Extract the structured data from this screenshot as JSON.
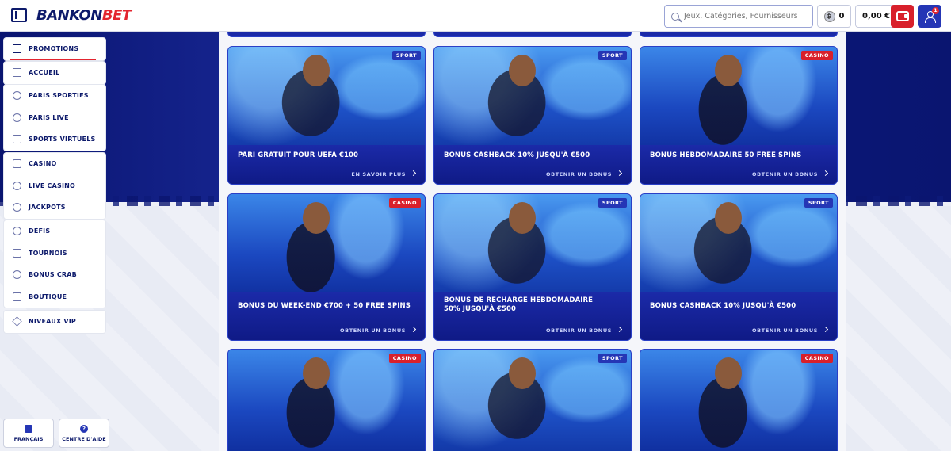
{
  "header": {
    "logo_main": "BANKON",
    "logo_accent": "BET",
    "search_placeholder": "Jeux, Catégories, Fournisseurs",
    "coins": "0",
    "balance": "0,00 €",
    "notification_count": "1"
  },
  "sidebar": {
    "groups": [
      [
        {
          "label": "PROMOTIONS",
          "icon": "gift-icon",
          "active": true
        }
      ],
      [
        {
          "label": "ACCUEIL",
          "icon": "home-icon"
        }
      ],
      [
        {
          "label": "PARIS SPORTIFS",
          "icon": "soccer-ball-icon"
        },
        {
          "label": "PARIS LIVE",
          "icon": "live-signal-icon"
        },
        {
          "label": "SPORTS VIRTUELS",
          "icon": "virtual-sports-icon"
        }
      ],
      [
        {
          "label": "CASINO",
          "icon": "casino-chip-icon"
        },
        {
          "label": "LIVE CASINO",
          "icon": "live-casino-icon"
        },
        {
          "label": "JACKPOTS",
          "icon": "jackpot-icon"
        }
      ],
      [
        {
          "label": "DÉFIS",
          "icon": "medal-icon"
        },
        {
          "label": "TOURNOIS",
          "icon": "trophy-icon"
        },
        {
          "label": "BONUS CRAB",
          "icon": "crab-icon"
        },
        {
          "label": "BOUTIQUE",
          "icon": "shop-bag-icon"
        }
      ],
      [
        {
          "label": "NIVEAUX VIP",
          "icon": "diamond-icon"
        }
      ]
    ],
    "footer": {
      "language": "FRANÇAIS",
      "help": "CENTRE D'AIDE",
      "help_glyph": "?"
    }
  },
  "cards": [
    {
      "title": "PARI GRATUIT POUR UEFA €100",
      "cta": "EN SAVOIR PLUS",
      "badge": "SPORT",
      "type": "sport"
    },
    {
      "title": "BONUS CASHBACK 10% JUSQU'À €500",
      "cta": "OBTENIR UN BONUS",
      "badge": "SPORT",
      "type": "sport"
    },
    {
      "title": "BONUS HEBDOMADAIRE 50 FREE SPINS",
      "cta": "OBTENIR UN BONUS",
      "badge": "CASINO",
      "type": "casino"
    },
    {
      "title": "BONUS DU WEEK-END €700 + 50 FREE SPINS",
      "cta": "OBTENIR UN BONUS",
      "badge": "CASINO",
      "type": "casino"
    },
    {
      "title": "BONUS DE RECHARGE HEBDOMADAIRE 50% JUSQU'À €500",
      "cta": "OBTENIR UN BONUS",
      "badge": "SPORT",
      "type": "sport"
    },
    {
      "title": "BONUS CASHBACK 10% JUSQU'À €500",
      "cta": "OBTENIR UN BONUS",
      "badge": "SPORT",
      "type": "sport"
    },
    {
      "title": "",
      "cta": "",
      "badge": "CASINO",
      "type": "casino"
    },
    {
      "title": "",
      "cta": "",
      "badge": "SPORT",
      "type": "sport"
    },
    {
      "title": "",
      "cta": "",
      "badge": "CASINO",
      "type": "casino"
    }
  ],
  "colors": {
    "brand_navy": "#0d1a6b",
    "brand_red": "#e3252f",
    "sport_badge": "#2536b5",
    "casino_badge": "#d8202b"
  }
}
